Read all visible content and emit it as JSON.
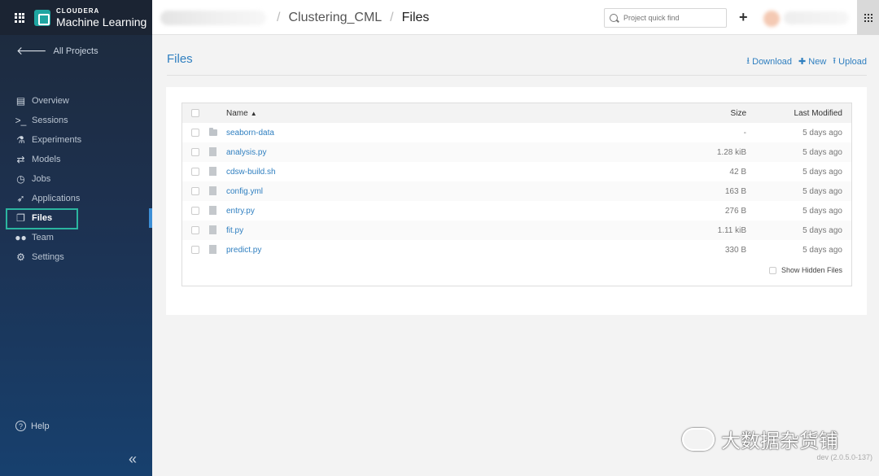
{
  "brand": {
    "top": "CLOUDERA",
    "bottom": "Machine Learning"
  },
  "sidebar": {
    "back_label": "All Projects",
    "items": [
      {
        "label": "Overview",
        "icon": "overview-icon"
      },
      {
        "label": "Sessions",
        "icon": "terminal-icon"
      },
      {
        "label": "Experiments",
        "icon": "flask-icon"
      },
      {
        "label": "Models",
        "icon": "arrows-icon"
      },
      {
        "label": "Jobs",
        "icon": "clock-icon"
      },
      {
        "label": "Applications",
        "icon": "rocket-icon"
      },
      {
        "label": "Files",
        "icon": "files-icon",
        "active": true
      },
      {
        "label": "Team",
        "icon": "team-icon"
      },
      {
        "label": "Settings",
        "icon": "gear-icon"
      }
    ],
    "help_label": "Help",
    "collapse_glyph": "«"
  },
  "topbar": {
    "crumb_project": "Clustering_CML",
    "crumb_separator": "/",
    "crumb_current": "Files",
    "search_placeholder": "Project quick find",
    "plus_glyph": "+"
  },
  "main": {
    "title": "Files",
    "actions": {
      "download": "Download",
      "new": "New",
      "upload": "Upload"
    },
    "table": {
      "headers": {
        "name": "Name",
        "size": "Size",
        "modified": "Last Modified"
      },
      "rows": [
        {
          "name": "seaborn-data",
          "type": "folder",
          "size": "-",
          "modified": "5 days ago"
        },
        {
          "name": "analysis.py",
          "type": "file",
          "size": "1.28 kiB",
          "modified": "5 days ago"
        },
        {
          "name": "cdsw-build.sh",
          "type": "file",
          "size": "42 B",
          "modified": "5 days ago"
        },
        {
          "name": "config.yml",
          "type": "file",
          "size": "163 B",
          "modified": "5 days ago"
        },
        {
          "name": "entry.py",
          "type": "file",
          "size": "276 B",
          "modified": "5 days ago"
        },
        {
          "name": "fit.py",
          "type": "file",
          "size": "1.11 kiB",
          "modified": "5 days ago"
        },
        {
          "name": "predict.py",
          "type": "file",
          "size": "330 B",
          "modified": "5 days ago"
        }
      ],
      "show_hidden_label": "Show Hidden Files"
    }
  },
  "watermark": "大数据杂货铺",
  "version": "dev (2.0.5.0-137)",
  "colors": {
    "accent": "#2f7fc0",
    "highlight": "#2bb5a0",
    "sidebar": "#1d3150"
  }
}
